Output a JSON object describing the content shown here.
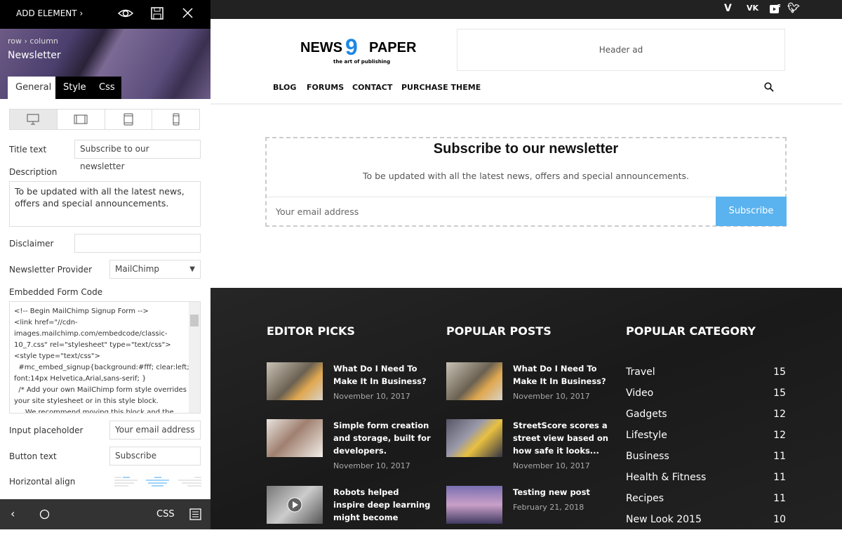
{
  "sidebar": {
    "add_element": "ADD ELEMENT",
    "breadcrumb": "row › column",
    "element_title": "Newsletter",
    "tabs": [
      "General",
      "Style",
      "Css"
    ],
    "fields": {
      "title_label": "Title text",
      "title_value": "Subscribe to our newsletter",
      "description_label": "Description",
      "description_value": "To be updated with all the latest news, offers and special announcements.",
      "disclaimer_label": "Disclaimer",
      "disclaimer_value": "",
      "provider_label": "Newsletter Provider",
      "provider_value": "MailChimp",
      "embed_label": "Embedded Form Code",
      "embed_lines": [
        "<!-- Begin MailChimp Signup Form -->",
        "<link href=\"//cdn-",
        "images.mailchimp.com/embedcode/classic-",
        "10_7.css\" rel=\"stylesheet\" type=\"text/css\">",
        "<style type=\"text/css\">",
        "  #mc_embed_signup{background:#fff; clear:left;",
        "font:14px Helvetica,Arial,sans-serif; }",
        "  /* Add your own MailChimp form style overrides in",
        "your site stylesheet or in this style block.",
        "     We recommend moving this block and the"
      ],
      "placeholder_label": "Input placeholder",
      "placeholder_value": "Your email address",
      "button_label": "Button text",
      "button_value": "Subscribe",
      "align_label": "Horizontal align"
    },
    "bottom": {
      "css": "CSS"
    }
  },
  "site": {
    "logo_text_left": "NEWS",
    "logo_text_right": "PAPER",
    "logo_tagline": "the art of publishing",
    "header_ad": "Header ad",
    "nav": [
      "BLOG",
      "FORUMS",
      "CONTACT",
      "PURCHASE THEME"
    ],
    "social_icons": [
      "facebook-icon",
      "twitter-icon",
      "vimeo-icon",
      "vk-icon",
      "youtube-icon"
    ],
    "newsletter": {
      "title": "Subscribe to our newsletter",
      "description": "To be updated with all the latest news, offers and special announcements.",
      "placeholder": "Your email address",
      "button": "Subscribe",
      "accent": "#5ab3ef"
    },
    "footer": {
      "editor_picks": {
        "heading": "EDITOR PICKS",
        "posts": [
          {
            "title": "What Do I Need To Make It In Business?",
            "date": "November 10, 2017"
          },
          {
            "title": "Simple form creation and storage, built for developers.",
            "date": "November 10, 2017"
          },
          {
            "title": "Robots helped inspire deep learning might become",
            "date": ""
          }
        ]
      },
      "popular_posts": {
        "heading": "POPULAR POSTS",
        "posts": [
          {
            "title": "What Do I Need To Make It In Business?",
            "date": "November 10, 2017"
          },
          {
            "title": "StreetScore scores a street view based on how safe it looks...",
            "date": "November 10, 2017"
          },
          {
            "title": "Testing new post",
            "date": "February 21, 2018"
          }
        ]
      },
      "popular_category": {
        "heading": "POPULAR CATEGORY",
        "items": [
          {
            "name": "Travel",
            "count": "15"
          },
          {
            "name": "Video",
            "count": "15"
          },
          {
            "name": "Gadgets",
            "count": "12"
          },
          {
            "name": "Lifestyle",
            "count": "12"
          },
          {
            "name": "Business",
            "count": "11"
          },
          {
            "name": "Health & Fitness",
            "count": "11"
          },
          {
            "name": "Recipes",
            "count": "11"
          },
          {
            "name": "New Look 2015",
            "count": "10"
          }
        ]
      }
    }
  }
}
